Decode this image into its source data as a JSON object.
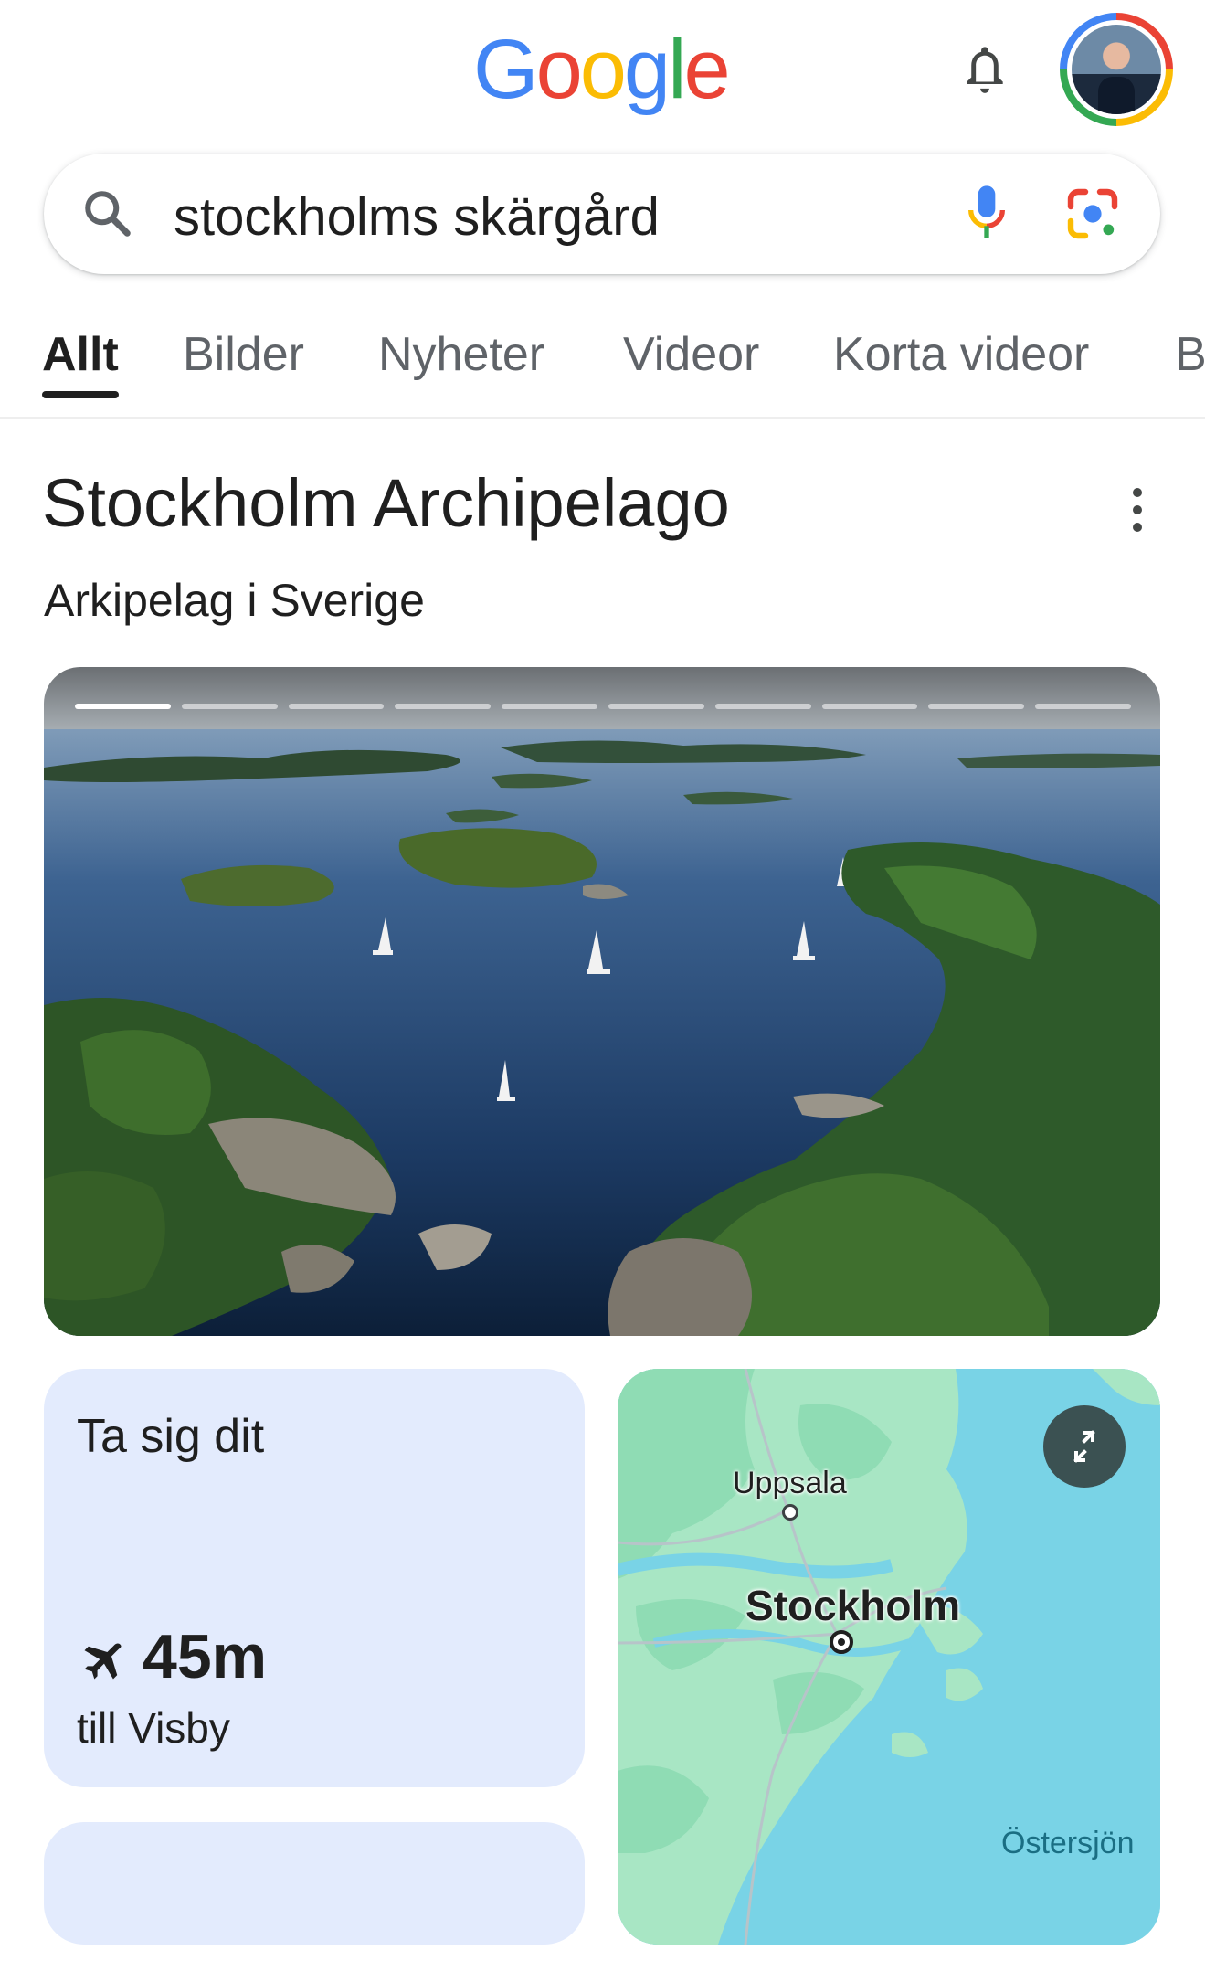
{
  "header": {
    "logo_letters": [
      "G",
      "o",
      "o",
      "g",
      "l",
      "e"
    ],
    "logo_colors": [
      "#4285f4",
      "#ea4335",
      "#fbbc04",
      "#4285f4",
      "#34a853",
      "#ea4335"
    ],
    "bell_icon": "bell-icon",
    "avatar_icon": "account-avatar"
  },
  "search": {
    "query": "stockholms skärgård",
    "search_icon": "search-icon",
    "mic_icon": "mic-icon",
    "lens_icon": "google-lens-icon"
  },
  "tabs": [
    {
      "label": "Allt",
      "active": true
    },
    {
      "label": "Bilder",
      "active": false
    },
    {
      "label": "Nyheter",
      "active": false
    },
    {
      "label": "Videor",
      "active": false
    },
    {
      "label": "Korta videor",
      "active": false
    },
    {
      "label": "B",
      "active": false
    }
  ],
  "knowledge_panel": {
    "title": "Stockholm Archipelago",
    "subtitle": "Arkipelag i Sverige",
    "more_icon": "more-vert-icon",
    "gallery": {
      "total_images": 10,
      "current_index": 1
    }
  },
  "travel_card": {
    "title": "Ta sig dit",
    "icon": "airplane-icon",
    "duration": "45m",
    "destination": "till Visby"
  },
  "map": {
    "labels": {
      "uppsala": "Uppsala",
      "stockholm": "Stockholm",
      "sea": "Östersjön"
    },
    "expand_icon": "expand-icon",
    "colors": {
      "water": "#79d3e6",
      "land": "#a8e6c4",
      "land_dark": "#8fdcb4"
    }
  },
  "colors": {
    "accent_blue": "#4285f4",
    "card_bg": "#e3ebfd",
    "text": "#1f1f1f",
    "muted": "#5f6368"
  }
}
